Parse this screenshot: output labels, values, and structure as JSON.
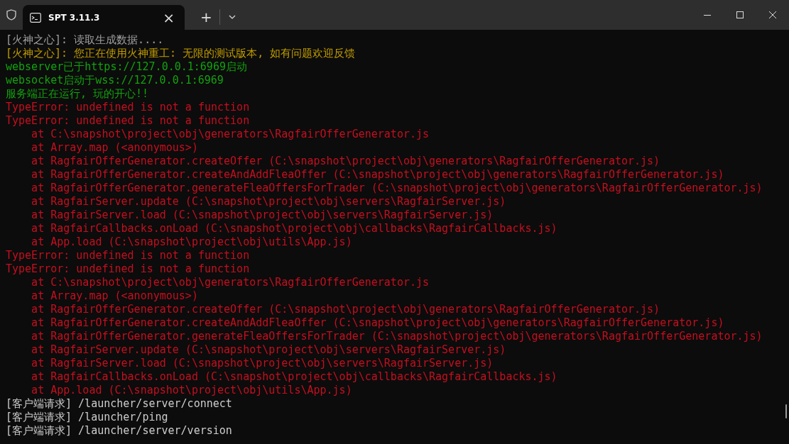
{
  "window": {
    "tab_title": "SPT 3.11.3",
    "tab_close": "×",
    "new_tab": "+"
  },
  "terminal": {
    "lines": [
      {
        "text": "[火神之心]: 读取生成数据....",
        "color": "#a0a0a0"
      },
      {
        "text": "[火神之心]: 您正在使用火神重工: 无限的测试版本, 如有问题欢迎反馈",
        "color": "#c19c00"
      },
      {
        "text": "webserver已于https://127.0.0.1:6969启动",
        "color": "#13a10e"
      },
      {
        "text": "websocket启动于wss://127.0.0.1:6969",
        "color": "#13a10e"
      },
      {
        "text": "服务端正在运行, 玩的开心!!",
        "color": "#13a10e"
      },
      {
        "text": "TypeError: undefined is not a function",
        "color": "#c50f1f"
      },
      {
        "text": "TypeError: undefined is not a function",
        "color": "#c50f1f"
      },
      {
        "text": "    at C:\\snapshot\\project\\obj\\generators\\RagfairOfferGenerator.js",
        "color": "#c50f1f"
      },
      {
        "text": "    at Array.map (<anonymous>)",
        "color": "#c50f1f"
      },
      {
        "text": "    at RagfairOfferGenerator.createOffer (C:\\snapshot\\project\\obj\\generators\\RagfairOfferGenerator.js)",
        "color": "#c50f1f"
      },
      {
        "text": "    at RagfairOfferGenerator.createAndAddFleaOffer (C:\\snapshot\\project\\obj\\generators\\RagfairOfferGenerator.js)",
        "color": "#c50f1f"
      },
      {
        "text": "    at RagfairOfferGenerator.generateFleaOffersForTrader (C:\\snapshot\\project\\obj\\generators\\RagfairOfferGenerator.js)",
        "color": "#c50f1f"
      },
      {
        "text": "    at RagfairServer.update (C:\\snapshot\\project\\obj\\servers\\RagfairServer.js)",
        "color": "#c50f1f"
      },
      {
        "text": "    at RagfairServer.load (C:\\snapshot\\project\\obj\\servers\\RagfairServer.js)",
        "color": "#c50f1f"
      },
      {
        "text": "    at RagfairCallbacks.onLoad (C:\\snapshot\\project\\obj\\callbacks\\RagfairCallbacks.js)",
        "color": "#c50f1f"
      },
      {
        "text": "    at App.load (C:\\snapshot\\project\\obj\\utils\\App.js)",
        "color": "#c50f1f"
      },
      {
        "text": "TypeError: undefined is not a function",
        "color": "#c50f1f"
      },
      {
        "text": "TypeError: undefined is not a function",
        "color": "#c50f1f"
      },
      {
        "text": "    at C:\\snapshot\\project\\obj\\generators\\RagfairOfferGenerator.js",
        "color": "#c50f1f"
      },
      {
        "text": "    at Array.map (<anonymous>)",
        "color": "#c50f1f"
      },
      {
        "text": "    at RagfairOfferGenerator.createOffer (C:\\snapshot\\project\\obj\\generators\\RagfairOfferGenerator.js)",
        "color": "#c50f1f"
      },
      {
        "text": "    at RagfairOfferGenerator.createAndAddFleaOffer (C:\\snapshot\\project\\obj\\generators\\RagfairOfferGenerator.js)",
        "color": "#c50f1f"
      },
      {
        "text": "    at RagfairOfferGenerator.generateFleaOffersForTrader (C:\\snapshot\\project\\obj\\generators\\RagfairOfferGenerator.js)",
        "color": "#c50f1f"
      },
      {
        "text": "    at RagfairServer.update (C:\\snapshot\\project\\obj\\servers\\RagfairServer.js)",
        "color": "#c50f1f"
      },
      {
        "text": "    at RagfairServer.load (C:\\snapshot\\project\\obj\\servers\\RagfairServer.js)",
        "color": "#c50f1f"
      },
      {
        "text": "    at RagfairCallbacks.onLoad (C:\\snapshot\\project\\obj\\callbacks\\RagfairCallbacks.js)",
        "color": "#c50f1f"
      },
      {
        "text": "    at App.load (C:\\snapshot\\project\\obj\\utils\\App.js)",
        "color": "#c50f1f"
      },
      {
        "text": "[客户端请求] /launcher/server/connect",
        "color": "#cccccc"
      },
      {
        "text": "[客户端请求] /launcher/ping",
        "color": "#cccccc"
      },
      {
        "text": "[客户端请求] /launcher/server/version",
        "color": "#cccccc"
      }
    ]
  }
}
